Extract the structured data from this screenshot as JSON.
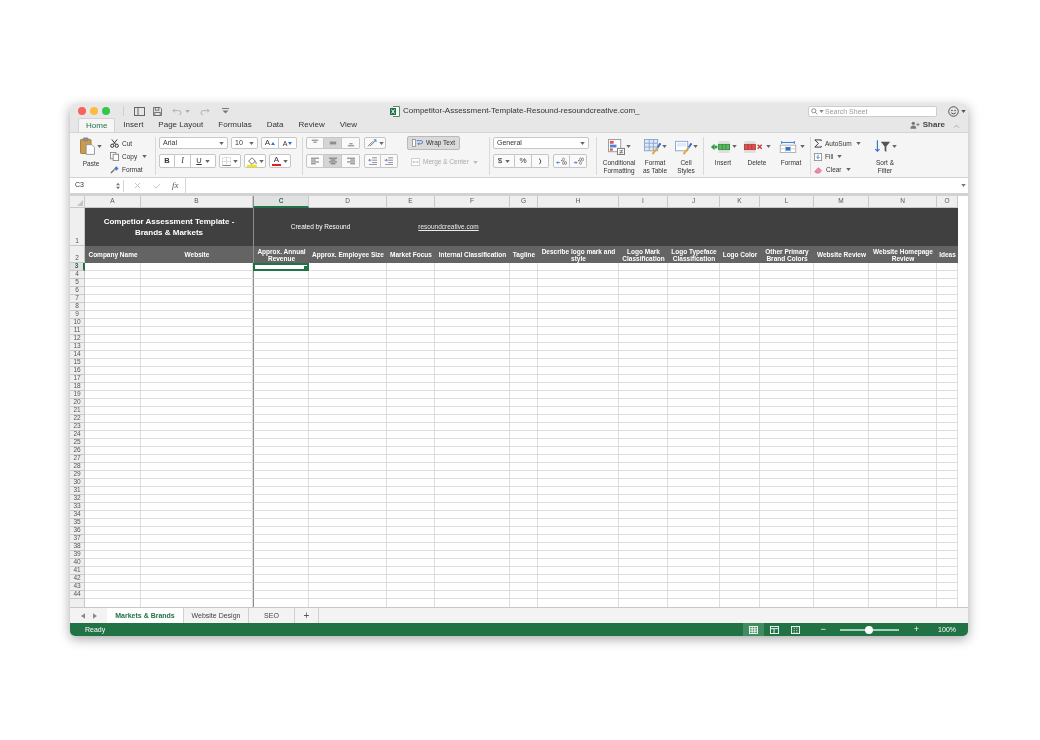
{
  "window": {
    "title": "Competitor-Assessment-Template-Resound-resoundcreative.com_"
  },
  "search": {
    "placeholder": "Search Sheet"
  },
  "ribbon_tabs": [
    {
      "label": "Home",
      "selected": true
    },
    {
      "label": "Insert",
      "selected": false
    },
    {
      "label": "Page Layout",
      "selected": false
    },
    {
      "label": "Formulas",
      "selected": false
    },
    {
      "label": "Data",
      "selected": false
    },
    {
      "label": "Review",
      "selected": false
    },
    {
      "label": "View",
      "selected": false
    }
  ],
  "share": "Share",
  "clipboard": {
    "paste": "Paste",
    "cut": "Cut",
    "copy": "Copy",
    "format": "Format"
  },
  "font": {
    "name": "Arial",
    "size": "10",
    "grow": "A",
    "shrink": "A",
    "bold": "B",
    "italic": "I",
    "underline": "U",
    "text_paint": "A"
  },
  "alignment": {
    "vertical": [
      {
        "kind": "top",
        "selected": false
      },
      {
        "kind": "middle",
        "selected": true
      },
      {
        "kind": "bottom",
        "selected": false
      }
    ],
    "horizontal": [
      {
        "kind": "left",
        "selected": false
      },
      {
        "kind": "center",
        "selected": true
      },
      {
        "kind": "right",
        "selected": false
      }
    ],
    "wrap_text": {
      "label": "Wrap Text",
      "on": true
    },
    "merge_center": {
      "label": "Merge & Center",
      "disabled": true
    }
  },
  "number": {
    "format": "General",
    "currency": "$",
    "percent": "%"
  },
  "styles": [
    {
      "kind": "conditional_formatting",
      "label": "Conditional\nFormatting"
    },
    {
      "kind": "format_as_table",
      "label": "Format\nas Table"
    },
    {
      "kind": "cell_styles",
      "label": "Cell\nStyles"
    }
  ],
  "cells": [
    {
      "kind": "insert",
      "label": "Insert"
    },
    {
      "kind": "delete",
      "label": "Delete"
    },
    {
      "kind": "format",
      "label": "Format"
    }
  ],
  "editing": {
    "autosum": "AutoSum",
    "fill": "Fill",
    "clear": "Clear",
    "sort_filter": "Sort &\nFilter"
  },
  "formula_bar": {
    "name_box": "C3",
    "function_label": "fx"
  },
  "sheet": {
    "columns": [
      {
        "label": "A",
        "selected": false
      },
      {
        "label": "B",
        "selected": false
      },
      {
        "label": "C",
        "selected": true
      },
      {
        "label": "D",
        "selected": false
      },
      {
        "label": "E",
        "selected": false
      },
      {
        "label": "F",
        "selected": false
      },
      {
        "label": "G",
        "selected": false
      },
      {
        "label": "H",
        "selected": false
      },
      {
        "label": "I",
        "selected": false
      },
      {
        "label": "J",
        "selected": false
      },
      {
        "label": "K",
        "selected": false
      },
      {
        "label": "L",
        "selected": false
      },
      {
        "label": "M",
        "selected": false
      },
      {
        "label": "N",
        "selected": false
      },
      {
        "label": "O",
        "selected": false
      }
    ],
    "rows": [
      {
        "label": "1",
        "selected": false
      },
      {
        "label": "2",
        "selected": false
      },
      {
        "label": "3",
        "selected": true
      },
      {
        "label": "4",
        "selected": false
      },
      {
        "label": "5",
        "selected": false
      },
      {
        "label": "6",
        "selected": false
      },
      {
        "label": "7",
        "selected": false
      },
      {
        "label": "8",
        "selected": false
      },
      {
        "label": "9",
        "selected": false
      },
      {
        "label": "10",
        "selected": false
      },
      {
        "label": "11",
        "selected": false
      },
      {
        "label": "12",
        "selected": false
      },
      {
        "label": "13",
        "selected": false
      },
      {
        "label": "14",
        "selected": false
      },
      {
        "label": "15",
        "selected": false
      },
      {
        "label": "16",
        "selected": false
      },
      {
        "label": "17",
        "selected": false
      },
      {
        "label": "18",
        "selected": false
      },
      {
        "label": "19",
        "selected": false
      },
      {
        "label": "20",
        "selected": false
      },
      {
        "label": "21",
        "selected": false
      },
      {
        "label": "22",
        "selected": false
      },
      {
        "label": "23",
        "selected": false
      },
      {
        "label": "24",
        "selected": false
      },
      {
        "label": "25",
        "selected": false
      },
      {
        "label": "26",
        "selected": false
      },
      {
        "label": "27",
        "selected": false
      },
      {
        "label": "28",
        "selected": false
      },
      {
        "label": "29",
        "selected": false
      },
      {
        "label": "30",
        "selected": false
      },
      {
        "label": "31",
        "selected": false
      },
      {
        "label": "32",
        "selected": false
      },
      {
        "label": "33",
        "selected": false
      },
      {
        "label": "34",
        "selected": false
      },
      {
        "label": "35",
        "selected": false
      },
      {
        "label": "36",
        "selected": false
      },
      {
        "label": "37",
        "selected": false
      },
      {
        "label": "38",
        "selected": false
      },
      {
        "label": "39",
        "selected": false
      },
      {
        "label": "40",
        "selected": false
      },
      {
        "label": "41",
        "selected": false
      },
      {
        "label": "42",
        "selected": false
      },
      {
        "label": "43",
        "selected": false
      },
      {
        "label": "44",
        "selected": false
      }
    ],
    "title": "Competior Assessment Template -\nBrands & Markets",
    "credit": "Created by Resound",
    "link": "resoundcreative.com",
    "headings": [
      "Company Name",
      "Website",
      "Approx. Annual\nRevenue",
      "Approx. Employee Size",
      "Market Focus",
      "Internal Classification",
      "Tagline",
      "Describe logo mark and\nstyle",
      "Logo Mark\nClassification",
      "Logo Typeface\nClassification",
      "Logo Color",
      "Other Primary\nBrand Colors",
      "Website Review",
      "Website Homepage\nReview",
      "Ideas"
    ]
  },
  "sheet_tabs": [
    {
      "label": "Markets & Brands",
      "selected": true
    },
    {
      "label": "Website Design",
      "selected": false
    },
    {
      "label": "SEO",
      "selected": false
    }
  ],
  "add_sheet": "+",
  "status_bar": {
    "status": "Ready",
    "views": [
      {
        "kind": "normal",
        "selected": true
      },
      {
        "kind": "page_layout",
        "selected": false
      },
      {
        "kind": "page_break",
        "selected": false
      }
    ],
    "zoom_out": "−",
    "zoom_in": "+",
    "zoom": {
      "level": 0.5,
      "reading": "100%"
    }
  }
}
